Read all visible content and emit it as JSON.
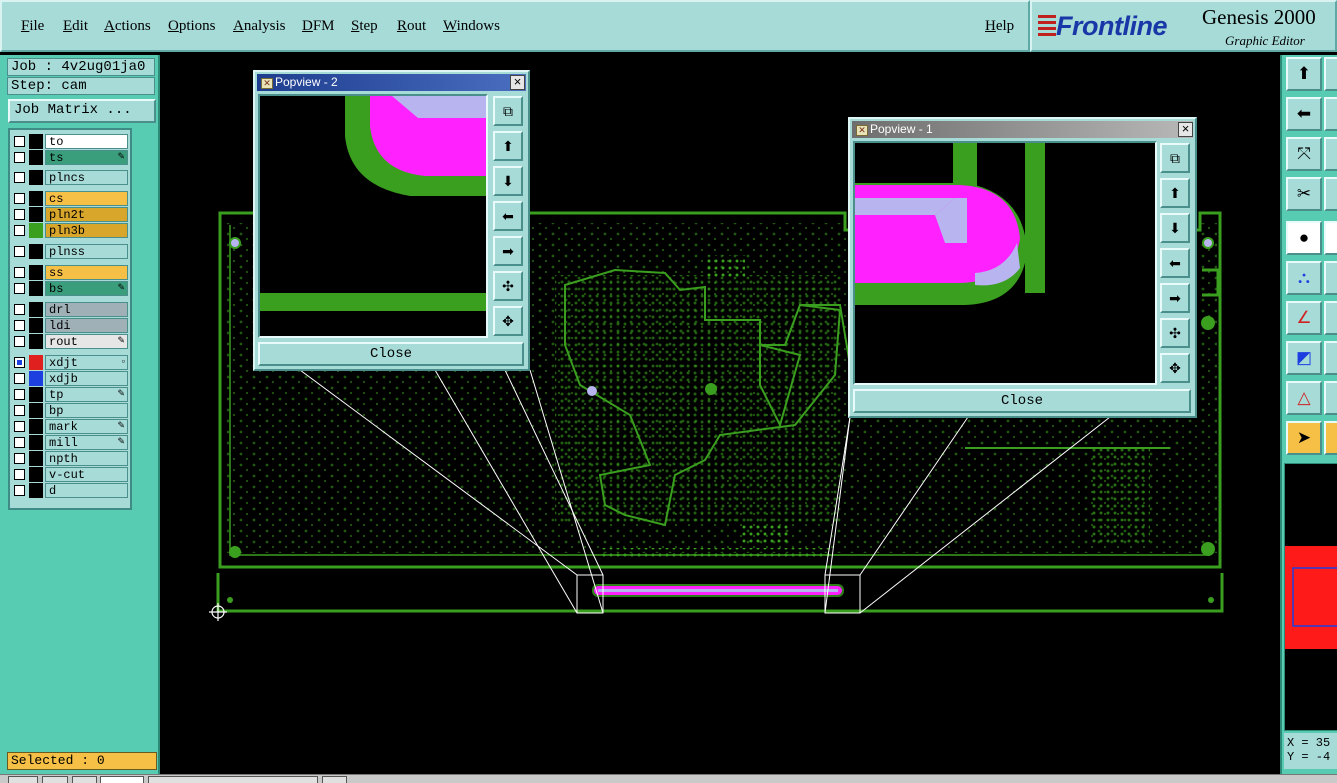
{
  "menubar": {
    "items": [
      "File",
      "Edit",
      "Actions",
      "Options",
      "Analysis",
      "DFM",
      "Step",
      "Rout",
      "Windows"
    ],
    "help": "Help"
  },
  "brand": {
    "logo": "Frontline",
    "title": "Genesis 2000",
    "subtitle": "Graphic Editor"
  },
  "job": {
    "job_label": "Job : 4v2ug01ja0",
    "step_label": "Step: cam",
    "matrix_button": "Job Matrix ..."
  },
  "layers": [
    {
      "name": "to",
      "swatch": "#000000",
      "bg": "#ffffff"
    },
    {
      "name": "ts",
      "swatch": "#000000",
      "bg": "#3a9e7d",
      "flag": "✎"
    },
    {
      "name": "plncs",
      "swatch": "#000000",
      "bg": "#a6dbd8"
    },
    {
      "name": "cs",
      "swatch": "#000000",
      "bg": "#f6c046"
    },
    {
      "name": "pln2t",
      "swatch": "#000000",
      "bg": "#d9a62c"
    },
    {
      "name": "pln3b",
      "swatch": "#3a9e1f",
      "bg": "#d9a62c"
    },
    {
      "name": "plnss",
      "swatch": "#000000",
      "bg": "#a6dbd8"
    },
    {
      "name": "ss",
      "swatch": "#000000",
      "bg": "#f6c046"
    },
    {
      "name": "bs",
      "swatch": "#000000",
      "bg": "#3a9e7d",
      "flag": "✎"
    },
    {
      "name": "drl",
      "swatch": "#000000",
      "bg": "#9fb0b6"
    },
    {
      "name": "ldi",
      "swatch": "#000000",
      "bg": "#9fb0b6"
    },
    {
      "name": "rout",
      "swatch": "#000000",
      "bg": "#e6e6e6",
      "flag": "✎"
    },
    {
      "name": "xdjt",
      "swatch": "#e0201e",
      "bg": "#a6dbd8",
      "flag": "▫",
      "checked": true
    },
    {
      "name": "xdjb",
      "swatch": "#1e3fe0",
      "bg": "#a6dbd8"
    },
    {
      "name": "tp",
      "swatch": "#000000",
      "bg": "#a6dbd8",
      "flag": "✎"
    },
    {
      "name": "bp",
      "swatch": "#000000",
      "bg": "#a6dbd8"
    },
    {
      "name": "mark",
      "swatch": "#000000",
      "bg": "#a6dbd8",
      "flag": "✎"
    },
    {
      "name": "mill",
      "swatch": "#000000",
      "bg": "#a6dbd8",
      "flag": "✎"
    },
    {
      "name": "npth",
      "swatch": "#000000",
      "bg": "#a6dbd8"
    },
    {
      "name": "v-cut",
      "swatch": "#000000",
      "bg": "#a6dbd8"
    },
    {
      "name": "d",
      "swatch": "#000000",
      "bg": "#a6dbd8"
    }
  ],
  "status": {
    "selected": "Selected : 0"
  },
  "popview2": {
    "title": "Popview - 2",
    "close": "Close"
  },
  "popview1": {
    "title": "Popview - 1",
    "close": "Close"
  },
  "coords": {
    "x": "X = 35",
    "y": "Y = -4"
  },
  "colors": {
    "board": "#3a9e1f",
    "highlight": "#ff22ff",
    "overlay": "#b8b4f0",
    "panel": "#a6dbd8",
    "toolbar": "#58cbb3"
  }
}
